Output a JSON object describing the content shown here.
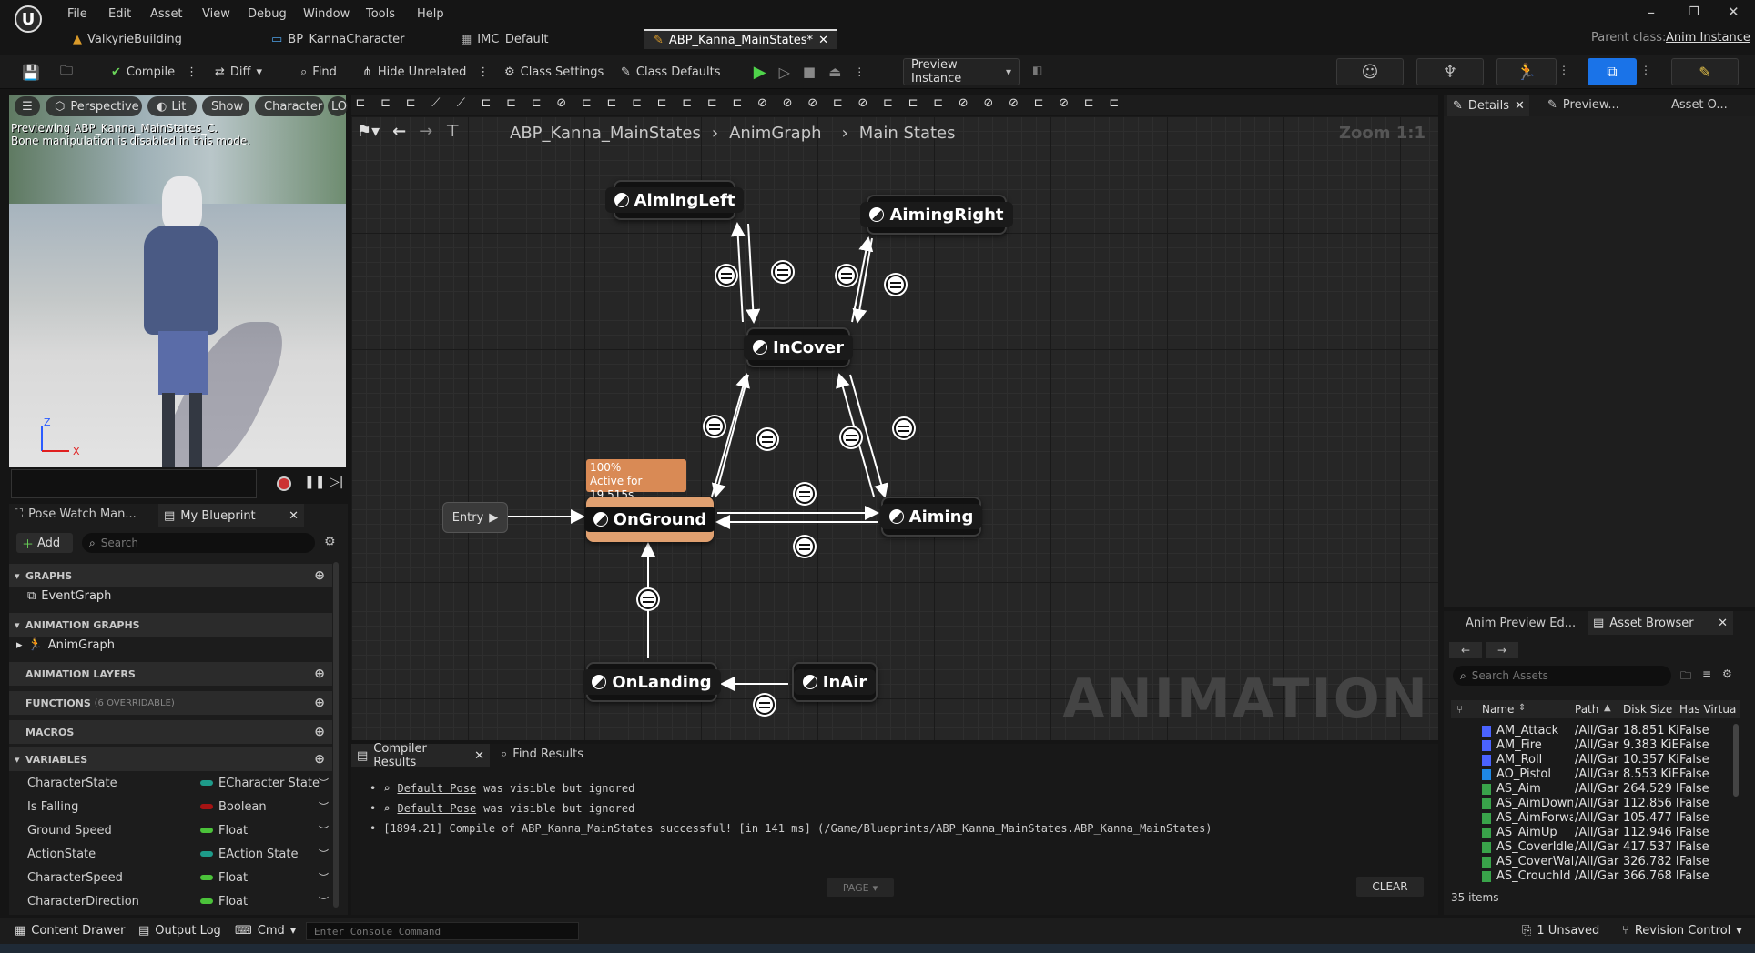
{
  "menu": [
    "File",
    "Edit",
    "Asset",
    "View",
    "Debug",
    "Window",
    "Tools",
    "Help"
  ],
  "tabs": [
    "ValkyrieBuilding",
    "BP_KannaCharacter",
    "IMC_Default",
    "ABP_Kanna_MainStates*"
  ],
  "parent_class_label": "Parent class:",
  "parent_class_value": "Anim Instance",
  "toolbar": {
    "compile": "Compile",
    "diff": "Diff",
    "find": "Find",
    "hide_unrelated": "Hide Unrelated",
    "class_settings": "Class Settings",
    "class_defaults": "Class Defaults",
    "preview_instance": "Preview Instance"
  },
  "viewport": {
    "perspective": "Perspective",
    "lit": "Lit",
    "show": "Show",
    "character": "Character",
    "lo": "LO",
    "msg1": "Previewing ABP_Kanna_MainStates_C.",
    "msg2": "Bone manipulation is disabled in this mode.",
    "axis_z": "Z",
    "axis_x": "X"
  },
  "leftpanel": {
    "tab1": "Pose Watch Man...",
    "tab2": "My Blueprint",
    "add": "Add",
    "search_placeholder": "Search",
    "graphs": "GRAPHS",
    "event_graph": "EventGraph",
    "anim_graphs": "ANIMATION GRAPHS",
    "anim_graph": "AnimGraph",
    "anim_layers": "ANIMATION LAYERS",
    "functions": "FUNCTIONS",
    "functions_note": "(6 OVERRIDABLE)",
    "macros": "MACROS",
    "variables": "VARIABLES",
    "vars": [
      {
        "name": "CharacterState",
        "type": "ECharacter State",
        "color": "#1e9b8a"
      },
      {
        "name": "Is Falling",
        "type": "Boolean",
        "color": "#a51313"
      },
      {
        "name": "Ground Speed",
        "type": "Float",
        "color": "#4bc23a"
      },
      {
        "name": "ActionState",
        "type": "EAction State",
        "color": "#1e9b8a"
      },
      {
        "name": "CharacterSpeed",
        "type": "Float",
        "color": "#4bc23a"
      },
      {
        "name": "CharacterDirection",
        "type": "Float",
        "color": "#4bc23a"
      }
    ]
  },
  "graph": {
    "breadcrumb": [
      "ABP_Kanna_MainStates",
      "AnimGraph",
      "Main States"
    ],
    "zoom": "Zoom 1:1",
    "watermark": "ANIMATION",
    "entry": "Entry",
    "active_pct": "100%",
    "active_time": "Active for 19.515s",
    "states": {
      "aiming_left": "AimingLeft",
      "aiming_right": "AimingRight",
      "in_cover": "InCover",
      "on_ground": "OnGround",
      "aiming": "Aiming",
      "on_landing": "OnLanding",
      "in_air": "InAir"
    }
  },
  "compiler": {
    "tab1": "Compiler Results",
    "tab2": "Find Results",
    "lines": [
      {
        "link": "Default Pose",
        "text": "was visible but ignored"
      },
      {
        "link": "Default Pose",
        "text": "was visible but ignored"
      }
    ],
    "summary": "[1894.21] Compile of ABP_Kanna_MainStates successful! [in 141 ms] (/Game/Blueprints/ABP_Kanna_MainStates.ABP_Kanna_MainStates)",
    "page": "PAGE",
    "clear": "CLEAR"
  },
  "details": {
    "tab1": "Details",
    "tab2": "Preview...",
    "tab3": "Asset O..."
  },
  "assets": {
    "tab1": "Anim Preview Ed...",
    "tab2": "Asset Browser",
    "search_placeholder": "Search Assets",
    "headers": [
      "Name",
      "Path",
      "Disk Size",
      "Has Virtua"
    ],
    "rows": [
      [
        "AM_Attack",
        "/All/Gar",
        "18.851 Ki",
        "False"
      ],
      [
        "AM_Fire",
        "/All/Gar",
        "9.383 KiE",
        "False"
      ],
      [
        "AM_Roll",
        "/All/Gar",
        "10.357 Ki",
        "False"
      ],
      [
        "AO_Pistol",
        "/All/Gar",
        "8.553 KiE",
        "False"
      ],
      [
        "AS_Aim",
        "/All/Gar",
        "264.529 I",
        "False"
      ],
      [
        "AS_AimDown",
        "/All/Gar",
        "112.856 I",
        "False"
      ],
      [
        "AS_AimForwa",
        "/All/Gar",
        "105.477 I",
        "False"
      ],
      [
        "AS_AimUp",
        "/All/Gar",
        "112.946 I",
        "False"
      ],
      [
        "AS_CoverIdle",
        "/All/Gar",
        "417.537 I",
        "False"
      ],
      [
        "AS_CoverWal",
        "/All/Gar",
        "326.782 I",
        "False"
      ],
      [
        "AS_CrouchId",
        "/All/Gar",
        "366.768 I",
        "False"
      ]
    ],
    "count": "35 items"
  },
  "statusbar": {
    "content_drawer": "Content Drawer",
    "output_log": "Output Log",
    "cmd": "Cmd",
    "console_placeholder": "Enter Console Command",
    "unsaved": "1 Unsaved",
    "revision": "Revision Control"
  }
}
